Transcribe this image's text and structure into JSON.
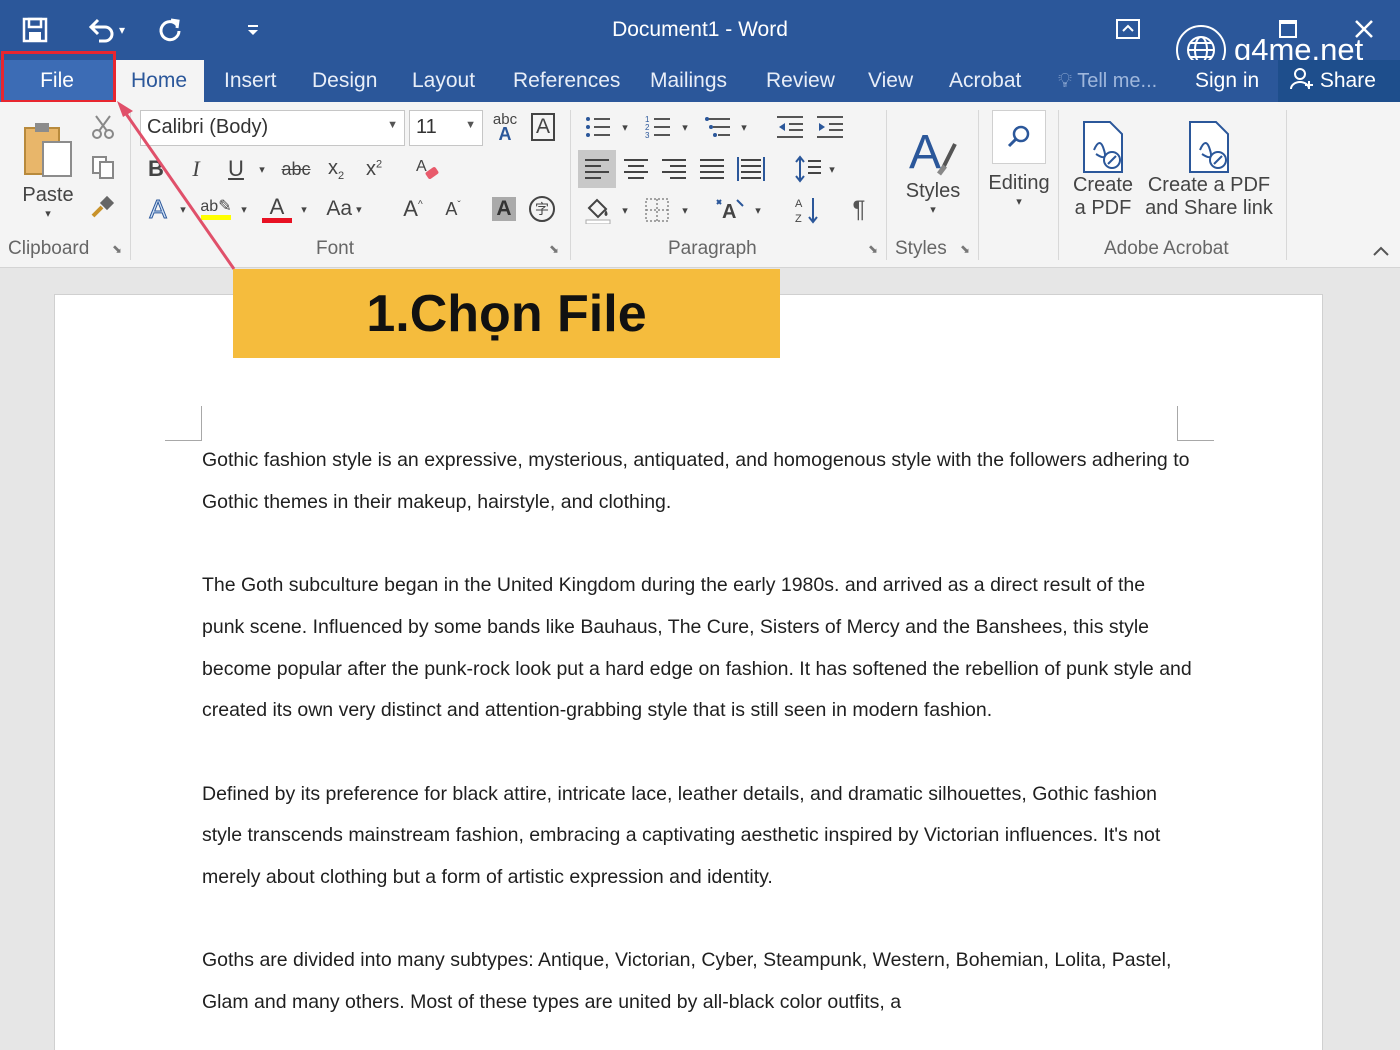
{
  "app": {
    "title": "Document1 - Word"
  },
  "quick_access": {
    "save_icon": "save-icon",
    "undo_icon": "undo-icon",
    "redo_icon": "redo-icon",
    "customize_icon": "customize-qat-icon"
  },
  "window_controls": {
    "ribbon_display_icon": "ribbon-display-options-icon",
    "maximize_icon": "maximize-icon",
    "close_icon": "close-icon"
  },
  "tabs": [
    {
      "label": "File"
    },
    {
      "label": "Home"
    },
    {
      "label": "Insert"
    },
    {
      "label": "Design"
    },
    {
      "label": "Layout"
    },
    {
      "label": "References"
    },
    {
      "label": "Mailings"
    },
    {
      "label": "Review"
    },
    {
      "label": "View"
    },
    {
      "label": "Acrobat"
    }
  ],
  "active_tab": "Home",
  "tell_me": "Tell me...",
  "sign_in": "Sign in",
  "share": "Share",
  "ribbon": {
    "clipboard": {
      "label": "Clipboard",
      "paste": "Paste"
    },
    "font": {
      "label": "Font",
      "font_name": "Calibri (Body)",
      "font_size": "11",
      "change_case": "Aa"
    },
    "paragraph": {
      "label": "Paragraph"
    },
    "styles": {
      "label": "Styles",
      "button": "Styles"
    },
    "editing": {
      "button": "Editing"
    },
    "adobe": {
      "label": "Adobe Acrobat",
      "create_pdf_line1": "Create",
      "create_pdf_line2": "a PDF",
      "share_pdf_line1": "Create a PDF",
      "share_pdf_line2": "and Share link"
    }
  },
  "annotation": {
    "callout": "1.Chọn File",
    "highlight_color": "#e8262f",
    "callout_color": "#f5bc3d"
  },
  "watermark": "g4me.net",
  "document": {
    "paragraphs": [
      "Gothic fashion style is an expressive, mysterious, antiquated, and homogenous style with the followers adhering to Gothic themes in their makeup, hairstyle, and clothing.",
      "The Goth subculture began in the United Kingdom during the early 1980s. and arrived as a direct result of the punk scene. Influenced by some bands like Bauhaus, The Cure, Sisters of Mercy and the Banshees, this style become popular after the punk-rock look put a hard edge on fashion. It has softened the rebellion of punk style and created its own very distinct and attention-grabbing style that is still seen in modern fashion.",
      "Defined by its preference for black attire, intricate lace, leather details, and dramatic silhouettes, Gothic fashion style transcends mainstream fashion, embracing a captivating aesthetic inspired by Victorian influences. It's not merely about clothing but a form of artistic expression and identity.",
      "Goths are divided into many subtypes: Antique, Victorian, Cyber, Steampunk, Western, Bohemian, Lolita, Pastel, Glam and many others. Most of these types are united by all-black color outfits, a"
    ]
  },
  "colors": {
    "word_blue": "#2b579a",
    "ribbon_bg": "#f4f4f4",
    "doc_bg": "#e6e6e6"
  }
}
